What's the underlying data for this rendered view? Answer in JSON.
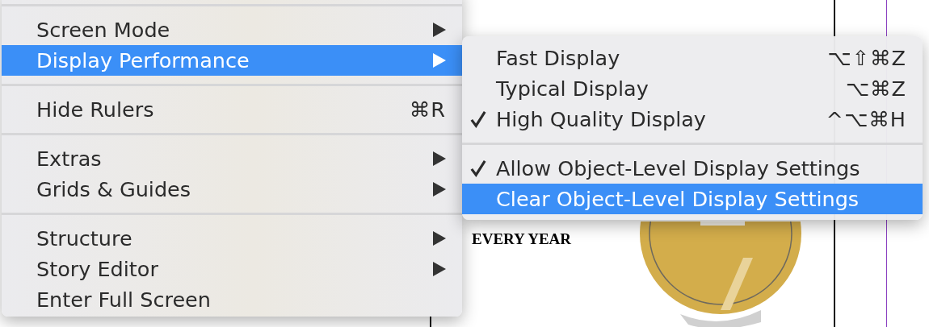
{
  "document": {
    "text": "EVERY YEAR"
  },
  "menu": {
    "items": [
      {
        "kind": "separator"
      },
      {
        "kind": "item",
        "label": "Screen Mode",
        "submenu": true,
        "selected": false
      },
      {
        "kind": "item",
        "label": "Display Performance",
        "submenu": true,
        "selected": true
      },
      {
        "kind": "separator"
      },
      {
        "kind": "item",
        "label": "Hide Rulers",
        "shortcut": "⌘R",
        "submenu": false,
        "selected": false
      },
      {
        "kind": "separator"
      },
      {
        "kind": "item",
        "label": "Extras",
        "submenu": true,
        "selected": false
      },
      {
        "kind": "item",
        "label": "Grids & Guides",
        "submenu": true,
        "selected": false
      },
      {
        "kind": "separator"
      },
      {
        "kind": "item",
        "label": "Structure",
        "submenu": true,
        "selected": false
      },
      {
        "kind": "item",
        "label": "Story Editor",
        "submenu": true,
        "selected": false
      },
      {
        "kind": "item",
        "label": "Enter Full Screen",
        "submenu": false,
        "selected": false
      }
    ]
  },
  "submenu": {
    "items": [
      {
        "kind": "item",
        "label": "Fast Display",
        "shortcut": "⌥⇧⌘Z",
        "checked": false,
        "selected": false
      },
      {
        "kind": "item",
        "label": "Typical Display",
        "shortcut": "⌥⌘Z",
        "checked": false,
        "selected": false
      },
      {
        "kind": "item",
        "label": "High Quality Display",
        "shortcut": "^⌥⌘H",
        "checked": true,
        "selected": false
      },
      {
        "kind": "separator"
      },
      {
        "kind": "item",
        "label": "Allow Object-Level Display Settings",
        "checked": true,
        "selected": false
      },
      {
        "kind": "item",
        "label": "Clear Object-Level Display Settings",
        "checked": false,
        "selected": true
      }
    ]
  }
}
